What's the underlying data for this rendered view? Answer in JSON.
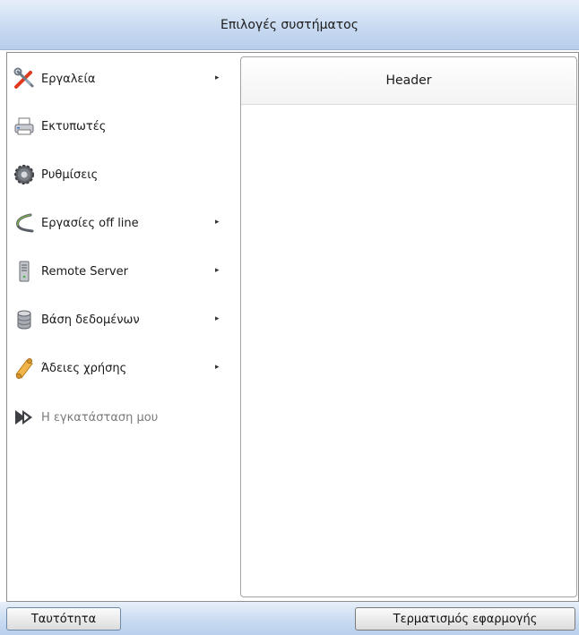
{
  "window": {
    "title": "Επιλογές συστήματος"
  },
  "menu": {
    "items": [
      {
        "label": "Εργαλεία",
        "icon": "tools-icon",
        "has_submenu": true,
        "enabled": true
      },
      {
        "label": "Εκτυπωτές",
        "icon": "printer-icon",
        "has_submenu": false,
        "enabled": true
      },
      {
        "label": "Ρυθμίσεις",
        "icon": "settings-gear-icon",
        "has_submenu": false,
        "enabled": true
      },
      {
        "label": "Εργασίες off line",
        "icon": "offline-cable-icon",
        "has_submenu": true,
        "enabled": true
      },
      {
        "label": "Remote Server",
        "icon": "server-icon",
        "has_submenu": true,
        "enabled": true
      },
      {
        "label": "Βάση δεδομένων",
        "icon": "database-icon",
        "has_submenu": true,
        "enabled": true
      },
      {
        "label": "Άδειες χρήσης",
        "icon": "license-scroll-icon",
        "has_submenu": true,
        "enabled": true
      },
      {
        "label": "Η εγκατάσταση μου",
        "icon": "installation-icon",
        "has_submenu": false,
        "enabled": false
      }
    ],
    "submenu_arrow": "▸"
  },
  "panel": {
    "header": "Header"
  },
  "footer": {
    "identity_button": "Ταυτότητα",
    "exit_button": "Τερματισμός εφαρμογής"
  }
}
